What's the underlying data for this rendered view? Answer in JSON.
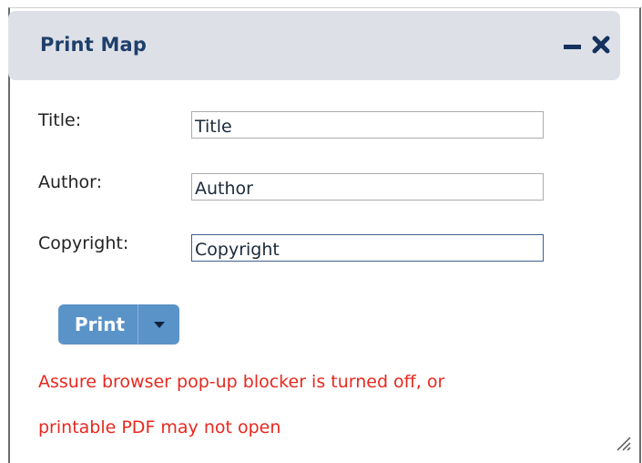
{
  "panel": {
    "title": "Print Map",
    "minimize_icon": "minimize-icon",
    "close_icon": "close-icon"
  },
  "form": {
    "title_label": "Title:",
    "title_value": "Title",
    "author_label": "Author:",
    "author_value": "Author",
    "copyright_label": "Copyright:",
    "copyright_value": "Copyright"
  },
  "actions": {
    "print_label": "Print",
    "dropdown_icon": "chevron-down-icon"
  },
  "warning": {
    "line1": "Assure browser pop-up blocker is turned off, or",
    "line2": "printable PDF may not open"
  },
  "colors": {
    "header_bg": "#dde1e7",
    "title_text": "#1f3f6b",
    "button_bg": "#5a93c8",
    "warning_text": "#e8281e"
  }
}
